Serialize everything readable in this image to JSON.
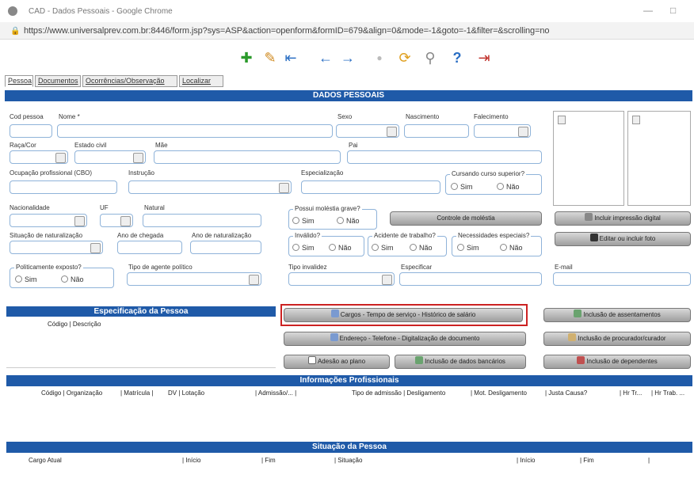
{
  "window": {
    "title": "CAD - Dados Pessoais - Google Chrome",
    "minimize": "—",
    "maximize": "□"
  },
  "address": {
    "url": "https://www.universalprev.com.br:8446/form.jsp?sys=ASP&action=openform&formID=679&align=0&mode=-1&goto=-1&filter=&scrolling=no"
  },
  "toolbar": {
    "icons": [
      "add-icon",
      "edit-icon",
      "first-icon",
      "prev-icon",
      "next-icon",
      "last-icon",
      "refresh-icon",
      "search-icon",
      "help-icon",
      "exit-icon"
    ]
  },
  "tabs": [
    {
      "label": "Pessoa"
    },
    {
      "label": "Documentos"
    },
    {
      "label": "Ocorrências/Observação"
    },
    {
      "label": "Localizar"
    }
  ],
  "section_title": "DADOS PESSOAIS",
  "fields": {
    "cod_pessoa": "Cod pessoa",
    "nome": "Nome *",
    "sexo": "Sexo",
    "nascimento": "Nascimento",
    "falecimento": "Falecimento",
    "raca_cor": "Raça/Cor",
    "estado_civil": "Estado civil",
    "mae": "Mãe",
    "pai": "Pai",
    "ocupacao": "Ocupação profissional (CBO)",
    "instrucao": "Instrução",
    "especializacao": "Especialização",
    "cursando": "Cursando curso superior?",
    "nacionalidade": "Nacionalidade",
    "uf": "UF",
    "natural": "Natural",
    "molestia": "Possui moléstia grave?",
    "sit_naturalizacao": "Situação de naturalização",
    "ano_chegada": "Ano de chegada",
    "ano_naturalizacao": "Ano de naturalização",
    "invalido": "Inválido?",
    "acidente": "Acidente de trabalho?",
    "necessidades": "Necessidades especiais?",
    "politicamente": "Politicamente exposto?",
    "agente_politico": "Tipo de agente político",
    "tipo_invalidez": "Tipo invalidez",
    "especificar": "Especificar",
    "email": "E-mail"
  },
  "radio": {
    "sim": "Sim",
    "nao": "Não"
  },
  "buttons": {
    "controle_molestia": "Controle de moléstia",
    "incluir_digital": "Incluir impressão digital",
    "editar_foto": "Editar ou incluir foto",
    "cargos": "Cargos - Tempo de serviço - Histórico de salário",
    "assentamentos": "Inclusão de assentamentos",
    "endereco": "Endereço - Telefone - Digitalização de documento",
    "procurador": "Inclusão de procurador/curador",
    "adesao": "Adesão ao plano",
    "dados_bancarios": "Inclusão de dados bancários",
    "dependentes": "Inclusão de dependentes"
  },
  "especificacao": {
    "title": "Especificação da Pessoa",
    "col": "Código | Descrição"
  },
  "info_prof": {
    "title": "Informações Profissionais",
    "cols": [
      "Código | Organização",
      "| Matrícula |",
      "DV | Lotação",
      "| Admissão/... |",
      "Tipo de admissão | Desligamento",
      "| Mot. Desligamento",
      "| Justa Causa?",
      "| Hr Tr...",
      "| Hr Trab. ..."
    ]
  },
  "situacao": {
    "title": "Situação da Pessoa",
    "cols": [
      "Cargo Atual",
      "| Início",
      "| Fim",
      "| Situação",
      "| Início",
      "| Fim",
      "|"
    ]
  },
  "colors": {
    "header": "#1f5aa8",
    "highlight": "#cc2222",
    "field_border": "#8fb3d9"
  }
}
